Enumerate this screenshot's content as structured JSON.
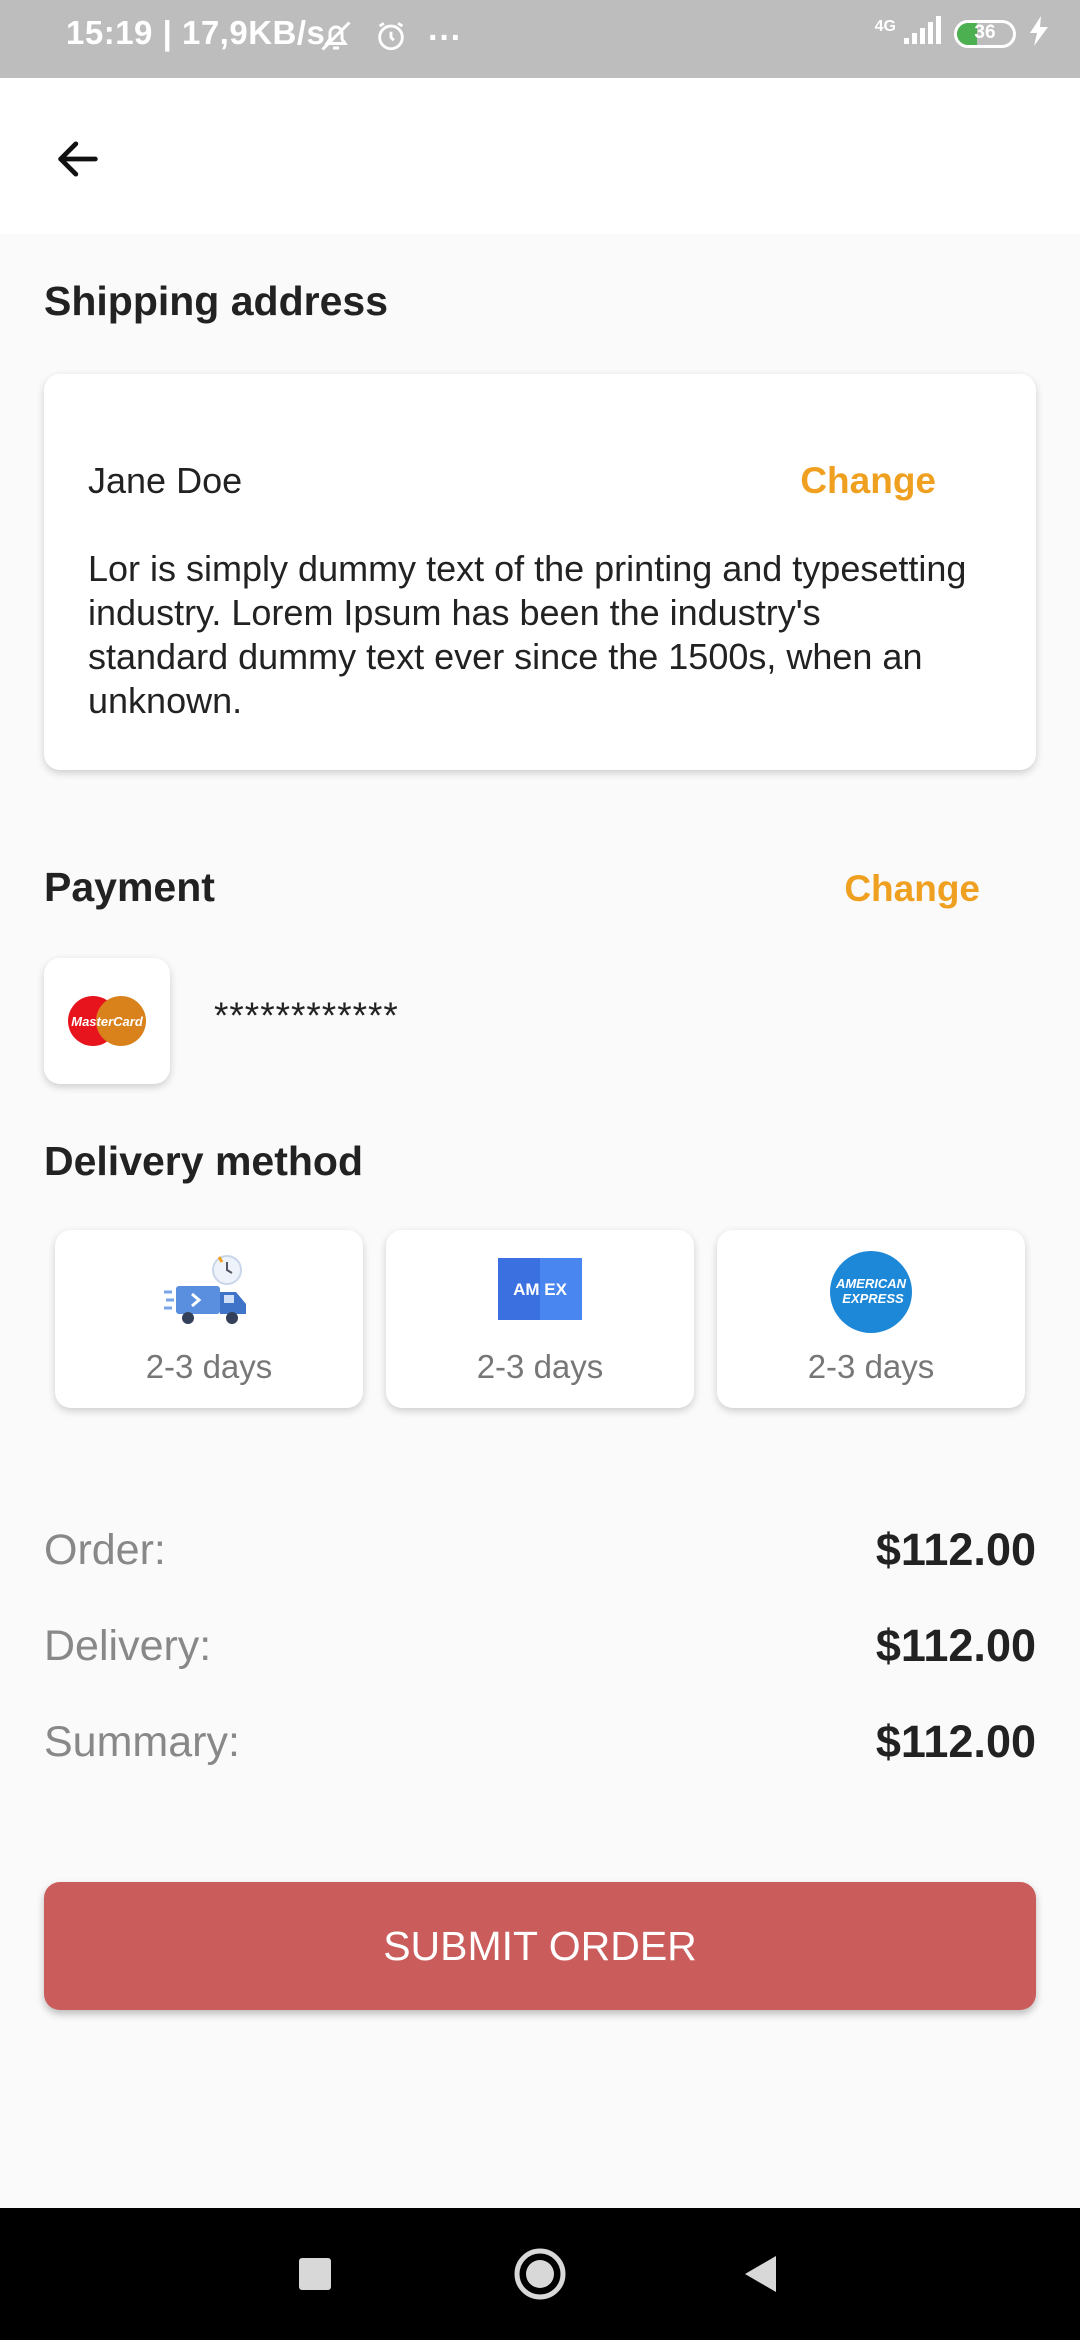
{
  "status_bar": {
    "time_speed": "15:19 | 17,9KB/s",
    "more": "···",
    "network": "4G",
    "battery": "36",
    "battery_level": 0.36
  },
  "shipping": {
    "title": "Shipping address",
    "name": "Jane Doe",
    "change_label": "Change",
    "address": "Lor is simply dummy text of the printing and typesetting industry. Lorem Ipsum has been the industry's standard dummy text ever since the 1500s, when an unknown."
  },
  "payment": {
    "title": "Payment",
    "change_label": "Change",
    "card_brand_text": "MasterCard",
    "masked_number": "************"
  },
  "delivery": {
    "title": "Delivery method",
    "options": [
      {
        "icon": "delivery-truck-icon",
        "label": "2-3 days"
      },
      {
        "icon": "amex-logo-icon",
        "label": "2-3 days",
        "logo_text": "AM EX"
      },
      {
        "icon": "american-express-icon",
        "label": "2-3 days",
        "logo_text": "AMERICAN EXPRESS"
      }
    ]
  },
  "summary": {
    "order_label": "Order:",
    "order_value": "$112.00",
    "delivery_label": "Delivery:",
    "delivery_value": "$112.00",
    "summary_label": "Summary:",
    "summary_value": "$112.00"
  },
  "submit_label": "SUBMIT ORDER",
  "colors": {
    "accent": "#f0a020",
    "submit": "#cb5c5c",
    "background": "#fafafa"
  }
}
